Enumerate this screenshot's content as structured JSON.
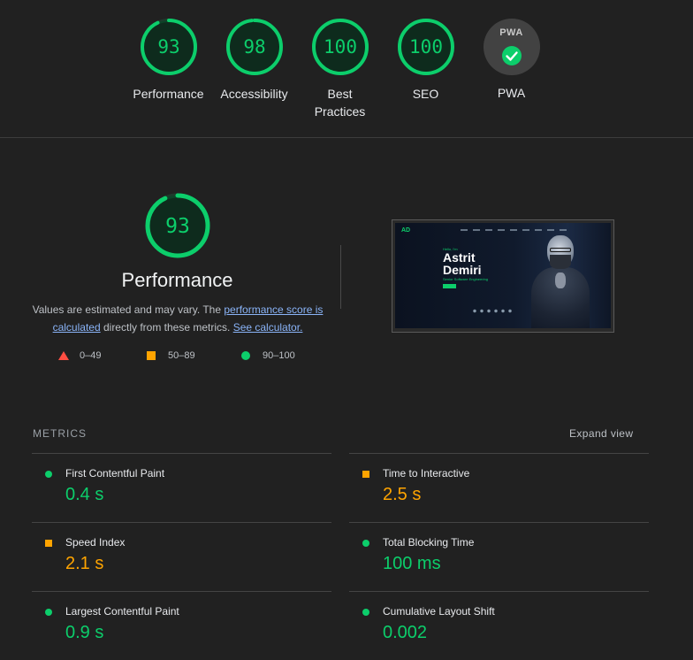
{
  "summary": {
    "gauges": [
      {
        "score": "93",
        "label": "Performance",
        "color": "#0cce6b",
        "fraction": 0.93
      },
      {
        "score": "98",
        "label": "Accessibility",
        "color": "#0cce6b",
        "fraction": 0.98
      },
      {
        "score": "100",
        "label_line1": "Best",
        "label_line2": "Practices",
        "color": "#0cce6b",
        "fraction": 1.0
      },
      {
        "score": "100",
        "label": "SEO",
        "color": "#0cce6b",
        "fraction": 1.0
      }
    ],
    "pwa": {
      "badge_text": "PWA",
      "label": "PWA",
      "icon": "check-circle-icon"
    }
  },
  "performance": {
    "score": "93",
    "fraction": 0.93,
    "title": "Performance",
    "desc_part1": "Values are estimated and may vary. The ",
    "link_score": "performance score is calculated",
    "desc_part2": " directly from these metrics. ",
    "link_calc": "See calculator.",
    "legend": [
      {
        "range": "0–49",
        "icon": "triangle-icon",
        "color": "#ff4e42"
      },
      {
        "range": "50–89",
        "icon": "square-icon",
        "color": "#ffa400"
      },
      {
        "range": "90–100",
        "icon": "circle-icon",
        "color": "#0cce6b"
      }
    ]
  },
  "thumbnail": {
    "logo": "AD",
    "greeting": "Hello, I'm",
    "name_line1": "Astrit",
    "name_line2": "Demiri",
    "subtitle": "Senior Software Engineering"
  },
  "metrics": {
    "title": "METRICS",
    "expand_label": "Expand view",
    "items": [
      {
        "name": "First Contentful Paint",
        "value": "0.4 s",
        "status": "good"
      },
      {
        "name": "Time to Interactive",
        "value": "2.5 s",
        "status": "average"
      },
      {
        "name": "Speed Index",
        "value": "2.1 s",
        "status": "average"
      },
      {
        "name": "Total Blocking Time",
        "value": "100 ms",
        "status": "good"
      },
      {
        "name": "Largest Contentful Paint",
        "value": "0.9 s",
        "status": "good"
      },
      {
        "name": "Cumulative Layout Shift",
        "value": "0.002",
        "status": "good"
      }
    ]
  },
  "colors": {
    "good": "#0cce6b",
    "average": "#ffa400",
    "poor": "#ff4e42",
    "background": "#212121"
  }
}
